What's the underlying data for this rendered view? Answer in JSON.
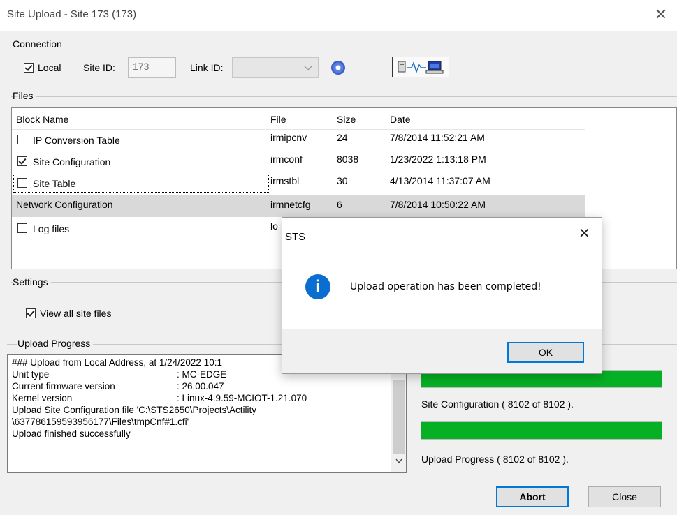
{
  "window": {
    "title": "Site Upload - Site 173 (173)",
    "close_glyph": "✕"
  },
  "connection": {
    "group_label": "Connection",
    "local_label": "Local",
    "local_checked": true,
    "site_id_label": "Site ID:",
    "site_id_value": "173",
    "link_id_label": "Link ID:",
    "link_id_value": ""
  },
  "files": {
    "group_label": "Files",
    "columns": [
      "Block Name",
      "File",
      "Size",
      "Date"
    ],
    "rows": [
      {
        "name": "IP Conversion Table",
        "file": "irmipcnv",
        "size": "24",
        "date": "7/8/2014 11:52:21 AM",
        "checked": false,
        "has_checkbox": true
      },
      {
        "name": "Site Configuration",
        "file": "irmconf",
        "size": "8038",
        "date": "1/23/2022 1:13:18 PM",
        "checked": true,
        "has_checkbox": true
      },
      {
        "name": "Site Table",
        "file": "irmstbl",
        "size": "30",
        "date": "4/13/2014 11:37:07 AM",
        "checked": false,
        "has_checkbox": true
      },
      {
        "name": "Network Configuration",
        "file": "irmnetcfg",
        "size": "6",
        "date": "7/8/2014 10:50:22 AM",
        "checked": false,
        "has_checkbox": false
      },
      {
        "name": "Log files",
        "file": "lo",
        "size": "",
        "date": "",
        "checked": false,
        "has_checkbox": true
      }
    ]
  },
  "settings": {
    "group_label": "Settings",
    "view_all_label": "View all site files",
    "view_all_checked": true
  },
  "upload_progress": {
    "group_label": "Upload Progress",
    "log_lines": [
      "### Upload from Local Address, at 1/24/2022 10:1",
      "Unit type",
      "Current firmware version",
      "Kernel version",
      "Upload Site Configuration file 'C:\\STS2650\\Projects\\Actility",
      "\\637786159593956177\\Files\\tmpCnf#1.cfi'",
      "Upload finished successfully"
    ],
    "log_values": [
      ": MC-EDGE",
      ": 26.00.047",
      ": Linux-4.9.59-MCIOT-1.21.070"
    ],
    "bar1_fraction": 1.0,
    "bar1_label": "Site Configuration ( 8102 of 8102 ).",
    "bar2_fraction": 1.0,
    "bar2_label": "Upload Progress ( 8102 of 8102 )."
  },
  "buttons": {
    "abort": "Abort",
    "close": "Close"
  },
  "dialog": {
    "title": "STS",
    "close_glyph": "✕",
    "message": "Upload operation has been completed!",
    "icon_glyph": "i",
    "ok": "OK"
  },
  "colors": {
    "progress_fill": "#06b025",
    "accent": "#0078d7",
    "info_icon": "#0a6ed1"
  }
}
